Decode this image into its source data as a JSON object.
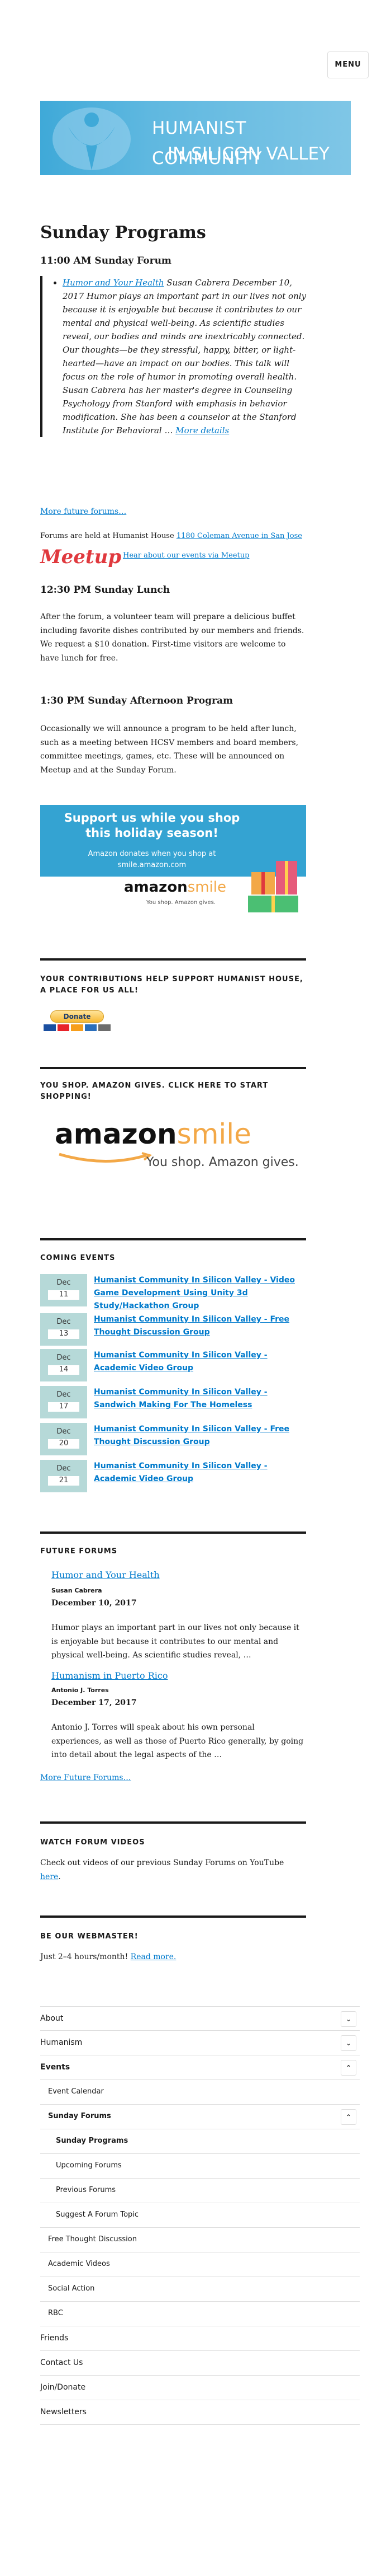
{
  "header": {
    "menu_label": "MENU"
  },
  "banner": {
    "line1": "HUMANIST COMMUNITY",
    "line2": "IN SILICON VALLEY"
  },
  "page_title": "Sunday Programs",
  "forum_section": {
    "heading": "11:00 AM Sunday Forum",
    "item_link": "Humor and Your Health",
    "item_text": " Susan Cabrera December 10, 2017 Humor plays an important part in our lives not only because it is enjoyable but because it contributes to our mental and physical well-being. As scientific studies reveal, our bodies and minds are inextricably connected. Our thoughts—be they stressful, happy, bitter, or light-hearted—have an impact on our bodies. This talk will focus on the role of humor in promoting overall health. Susan Cabrera has her master's degree in Counseling Psychology from Stanford with emphasis in behavior modification. She has been a counselor at the Stanford Institute for Behavioral …",
    "more_details": "More details",
    "more_forums": "More future forums…",
    "held_at_prefix": "Forums are held at Humanist House ",
    "held_at_link": "1180 Coleman Avenue in San Jose",
    "meetup_logo": "Meetup",
    "meetup_link": "Hear about our events via Meetup"
  },
  "lunch_section": {
    "heading": "12:30 PM Sunday Lunch",
    "text": "After the forum, a volunteer team will prepare a delicious buffet including favorite dishes contributed by our members and friends. We request a $10 donation. First-time visitors are welcome to have lunch for free."
  },
  "afternoon_section": {
    "heading": "1:30 PM Sunday Afternoon Program",
    "text": "Occasionally we will announce a program to be held after lunch, such as a meeting between HCSV members and board members, committee meetings, games, etc. These will be announced on Meetup and at the Sunday Forum."
  },
  "amazon_banner": {
    "line1": "Support us while you shop",
    "line2": "this holiday season!",
    "line3": "Amazon donates when you shop at",
    "line4": "smile.amazon.com",
    "logo_a": "amazon",
    "logo_b": "smile",
    "tagline": "You shop. Amazon gives."
  },
  "contrib_widget": {
    "heading": "YOUR CONTRIBUTIONS HELP SUPPORT HUMANIST HOUSE, A PLACE FOR US ALL!",
    "donate_label": "Donate"
  },
  "amazon_widget": {
    "heading": "YOU SHOP. AMAZON GIVES. CLICK HERE TO START SHOPPING!",
    "logo_a": "amazon",
    "logo_b": "smile",
    "tagline": "You shop. Amazon gives."
  },
  "coming_events": {
    "heading": "COMING EVENTS",
    "events": [
      {
        "month": "Dec",
        "day": "11",
        "title": "Humanist Community In Silicon Valley - Video Game Development Using Unity 3d Study/Hackathon Group"
      },
      {
        "month": "Dec",
        "day": "13",
        "title": "Humanist Community In Silicon Valley - Free Thought Discussion Group"
      },
      {
        "month": "Dec",
        "day": "14",
        "title": "Humanist Community In Silicon Valley - Academic Video Group"
      },
      {
        "month": "Dec",
        "day": "17",
        "title": "Humanist Community In Silicon Valley - Sandwich Making For The Homeless"
      },
      {
        "month": "Dec",
        "day": "20",
        "title": "Humanist Community In Silicon Valley - Free Thought Discussion Group"
      },
      {
        "month": "Dec",
        "day": "21",
        "title": "Humanist Community In Silicon Valley - Academic Video Group"
      }
    ]
  },
  "future_forums": {
    "heading": "FUTURE FORUMS",
    "items": [
      {
        "title": "Humor and Your Health",
        "speaker": "Susan Cabrera",
        "date": "December 10, 2017",
        "text": "Humor plays an important part in our lives not only because it is enjoyable but because it contributes to our mental and physical well-being. As scientific studies reveal, …"
      },
      {
        "title": "Humanism in Puerto Rico",
        "speaker": "Antonio J. Torres",
        "date": "December 17, 2017",
        "text": "Antonio J. Torres will speak about his own personal experiences, as well as those of Puerto Rico generally, by going into detail about the legal aspects of the …"
      }
    ],
    "more": "More Future Forums…"
  },
  "videos_widget": {
    "heading": "WATCH FORUM VIDEOS",
    "text": "Check out videos of our previous Sunday Forums on YouTube ",
    "link": "here",
    "tail": "."
  },
  "webmaster_widget": {
    "heading": "BE OUR WEBMASTER!",
    "text": "Just 2–4 hours/month! ",
    "link": "Read more."
  },
  "nav": {
    "about": "About",
    "humanism": "Humanism",
    "events": "Events",
    "event_calendar": "Event Calendar",
    "sunday_forums": "Sunday Forums",
    "sunday_programs": "Sunday Programs",
    "upcoming_forums": "Upcoming Forums",
    "previous_forums": "Previous Forums",
    "suggest_topic": "Suggest A Forum Topic",
    "free_thought": "Free Thought Discussion",
    "academic_videos": "Academic Videos",
    "social_action": "Social Action",
    "rbc": "RBC",
    "friends": "Friends",
    "contact_us": "Contact Us",
    "join_donate": "Join/Donate",
    "newsletters": "Newsletters"
  },
  "colors": {
    "link": "#007acc",
    "banner_blue": "#3fa9d8",
    "event_date_bg": "#b6d9d8",
    "amazon_orange": "#f3a847"
  }
}
